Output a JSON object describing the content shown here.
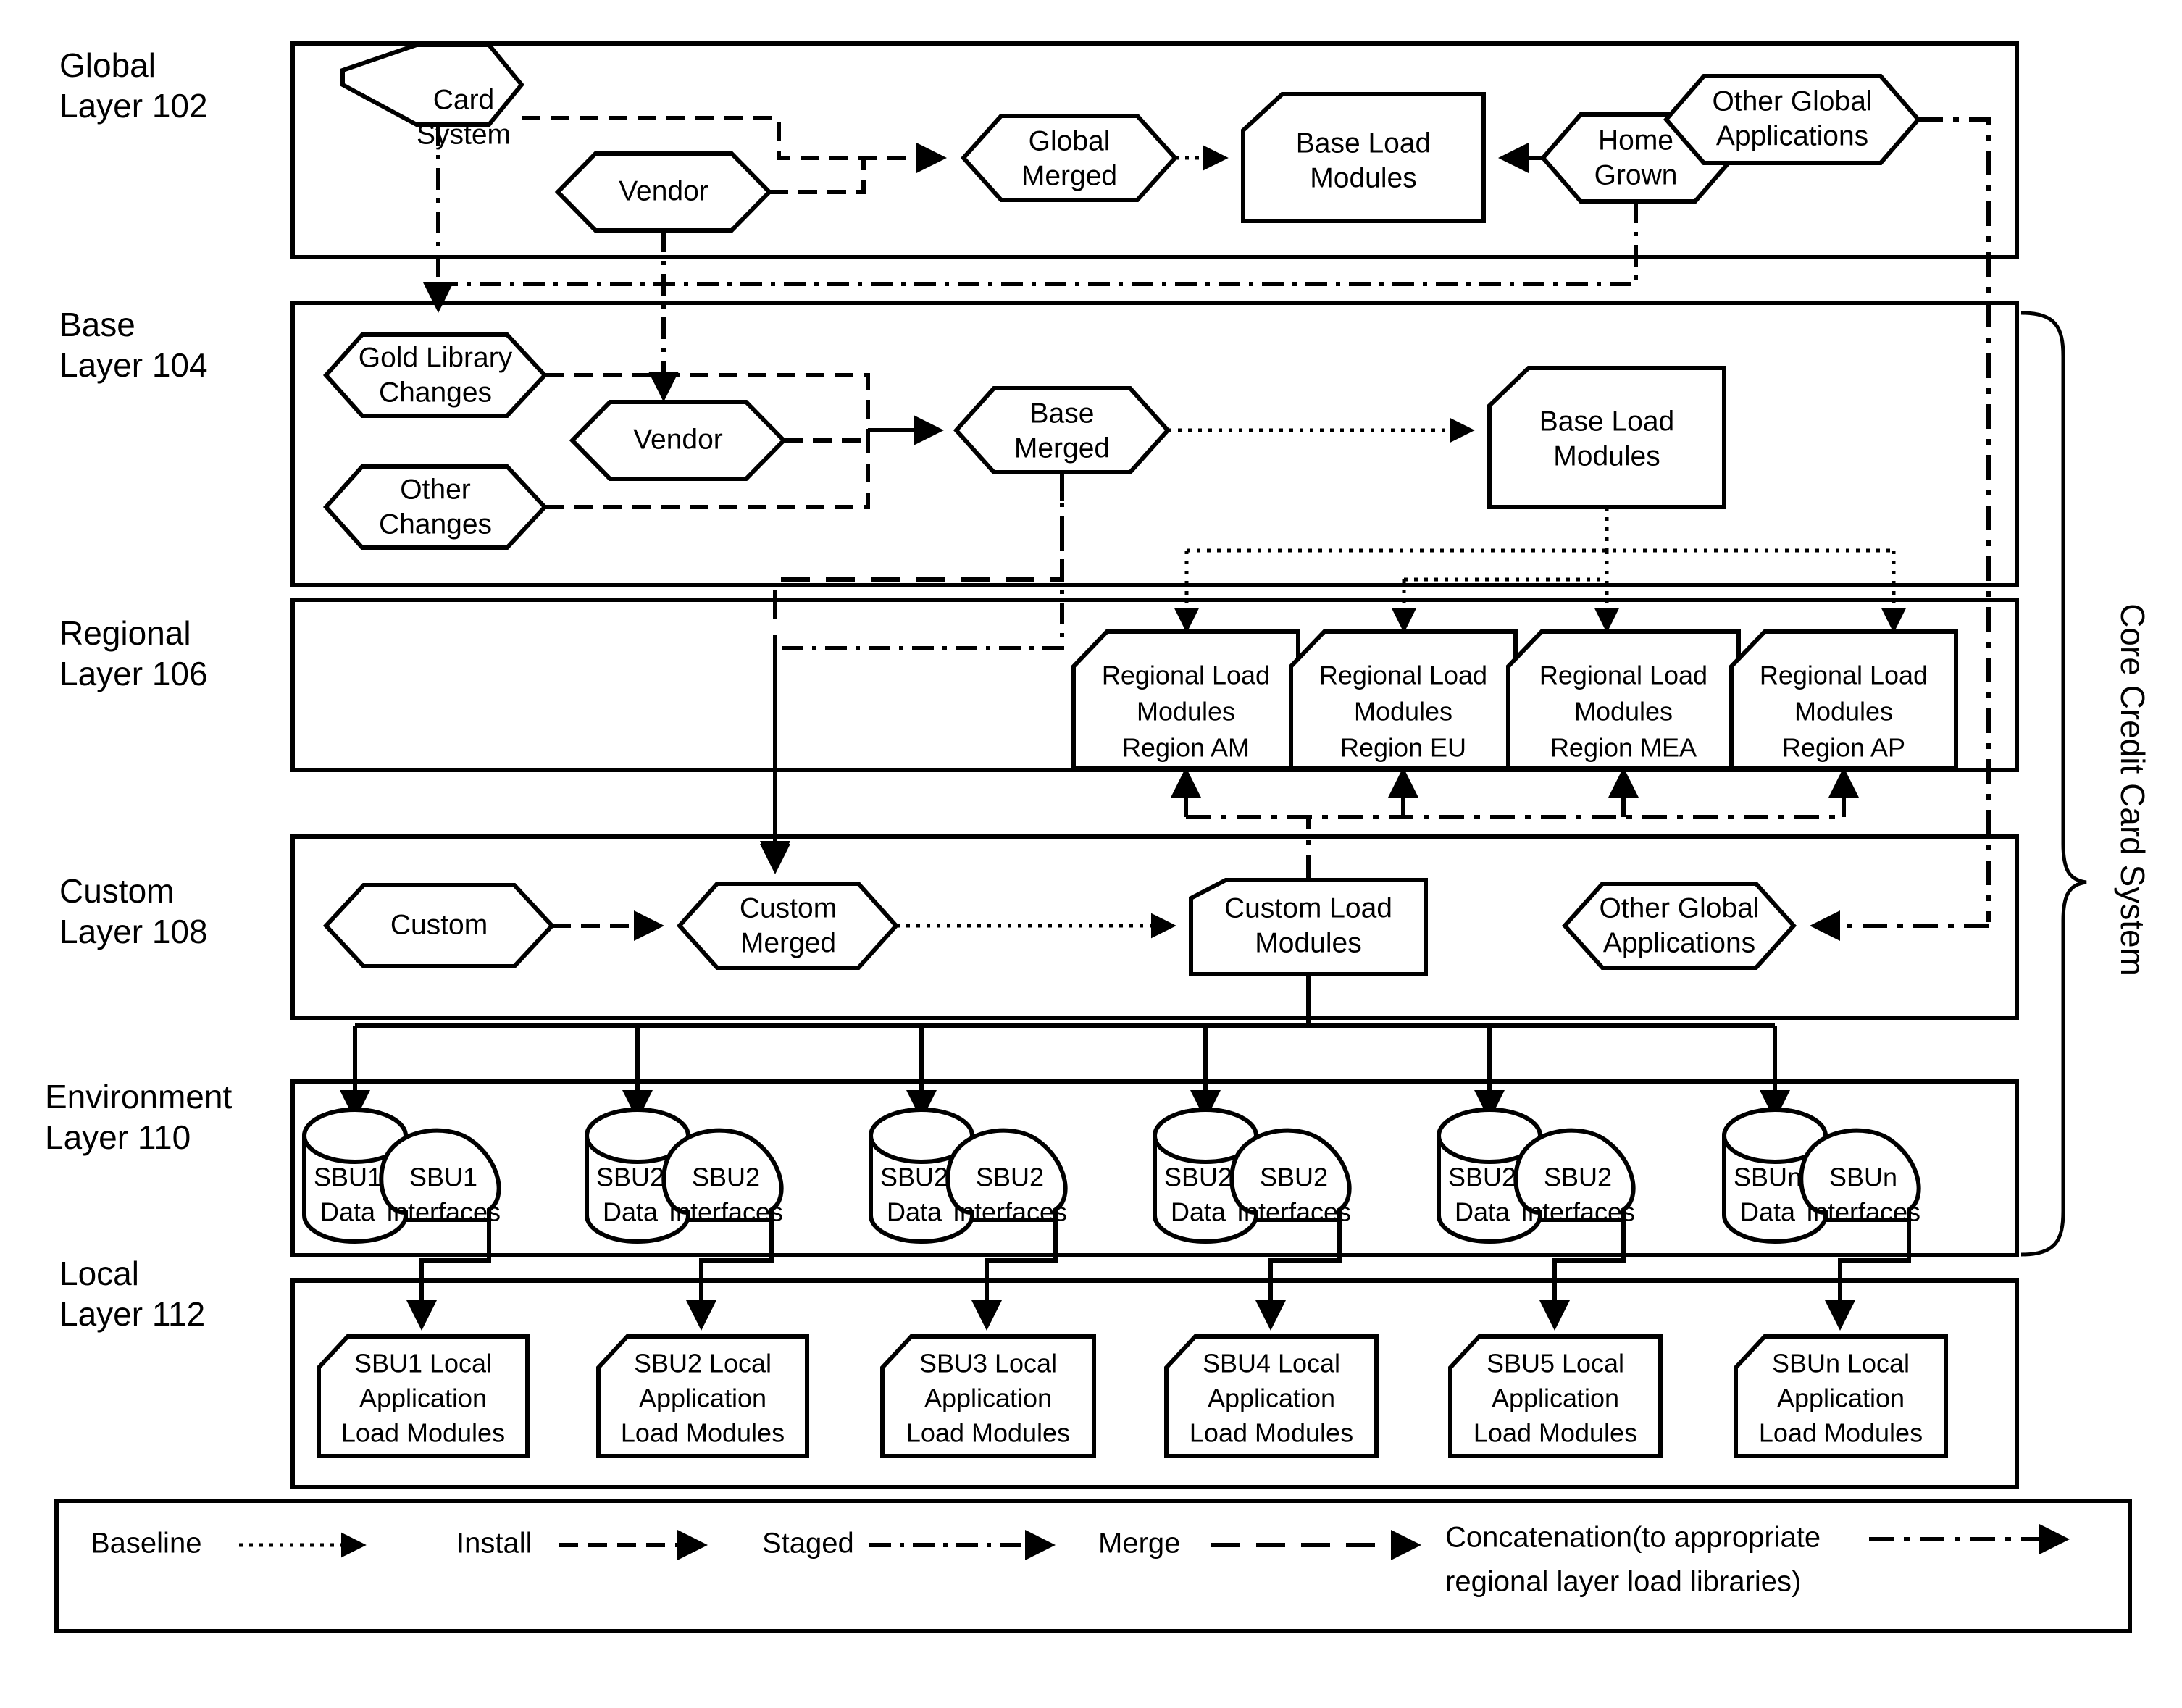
{
  "layers": [
    {
      "id": "global",
      "name": "Global",
      "ref": "Layer 102"
    },
    {
      "id": "base",
      "name": "Base",
      "ref": "Layer 104"
    },
    {
      "id": "regional",
      "name": "Regional",
      "ref": "Layer 106"
    },
    {
      "id": "custom",
      "name": "Custom",
      "ref": "Layer 108"
    },
    {
      "id": "environment",
      "name": "Environment",
      "ref": "Layer 110"
    },
    {
      "id": "local",
      "name": "Local",
      "ref": "Layer 112"
    }
  ],
  "bracket": {
    "label": "Core Credit Card System"
  },
  "global_layer": {
    "nodes": {
      "card_system": {
        "line1": "Card",
        "line2": "System"
      },
      "vendor": {
        "line1": "Vendor",
        "line2": ""
      },
      "global_merged": {
        "line1": "Global",
        "line2": "Merged"
      },
      "base_load_modules": {
        "line1": "Base Load",
        "line2": "Modules"
      },
      "home_grown": {
        "line1": "Home",
        "line2": "Grown"
      },
      "other_global_apps": {
        "line1": "Other Global",
        "line2": "Applications"
      }
    }
  },
  "base_layer": {
    "nodes": {
      "gold_library_changes": {
        "line1": "Gold Library",
        "line2": "Changes"
      },
      "other_changes": {
        "line1": "Other",
        "line2": "Changes"
      },
      "vendor": {
        "line1": "Vendor",
        "line2": ""
      },
      "base_merged": {
        "line1": "Base",
        "line2": "Merged"
      },
      "base_load_modules": {
        "line1": "Base Load",
        "line2": "Modules"
      }
    }
  },
  "regional_layer": {
    "nodes": [
      {
        "line1": "Regional Load",
        "line2": "Modules",
        "line3": "Region AM"
      },
      {
        "line1": "Regional Load",
        "line2": "Modules",
        "line3": "Region EU"
      },
      {
        "line1": "Regional Load",
        "line2": "Modules",
        "line3": "Region MEA"
      },
      {
        "line1": "Regional Load",
        "line2": "Modules",
        "line3": "Region AP"
      }
    ]
  },
  "custom_layer": {
    "nodes": {
      "custom": {
        "line1": "Custom",
        "line2": ""
      },
      "custom_merged": {
        "line1": "Custom",
        "line2": "Merged"
      },
      "custom_load_modules": {
        "line1": "Custom Load",
        "line2": "Modules"
      },
      "other_global_apps": {
        "line1": "Other Global",
        "line2": "Applications"
      }
    }
  },
  "environment_layer": {
    "nodes": [
      {
        "data_line1": "SBU1",
        "data_line2": "Data",
        "iface_line1": "SBU1",
        "iface_line2": "Interfaces"
      },
      {
        "data_line1": "SBU2",
        "data_line2": "Data",
        "iface_line1": "SBU2",
        "iface_line2": "Interfaces"
      },
      {
        "data_line1": "SBU2",
        "data_line2": "Data",
        "iface_line1": "SBU2",
        "iface_line2": "Interfaces"
      },
      {
        "data_line1": "SBU2",
        "data_line2": "Data",
        "iface_line1": "SBU2",
        "iface_line2": "Interfaces"
      },
      {
        "data_line1": "SBU2",
        "data_line2": "Data",
        "iface_line1": "SBU2",
        "iface_line2": "Interfaces"
      },
      {
        "data_line1": "SBUn",
        "data_line2": "Data",
        "iface_line1": "SBUn",
        "iface_line2": "Interfaces"
      }
    ]
  },
  "local_layer": {
    "nodes": [
      {
        "line1": "SBU1 Local",
        "line2": "Application",
        "line3": "Load Modules"
      },
      {
        "line1": "SBU2 Local",
        "line2": "Application",
        "line3": "Load Modules"
      },
      {
        "line1": "SBU3 Local",
        "line2": "Application",
        "line3": "Load Modules"
      },
      {
        "line1": "SBU4 Local",
        "line2": "Application",
        "line3": "Load Modules"
      },
      {
        "line1": "SBU5 Local",
        "line2": "Application",
        "line3": "Load Modules"
      },
      {
        "line1": "SBUn Local",
        "line2": "Application",
        "line3": "Load Modules"
      }
    ]
  },
  "legend": {
    "items": [
      {
        "label": "Baseline",
        "style": "dotted"
      },
      {
        "label": "Install",
        "style": "dash-dot"
      },
      {
        "label": "Staged",
        "style": "dash-dot-dot"
      },
      {
        "label": "Merge",
        "style": "dashed"
      },
      {
        "label": "Concatenation(to appropriate",
        "label2": "regional layer load libraries)",
        "style": "dash-dot-long"
      }
    ]
  },
  "colors": {
    "stroke": "#000000",
    "background": "#ffffff"
  }
}
